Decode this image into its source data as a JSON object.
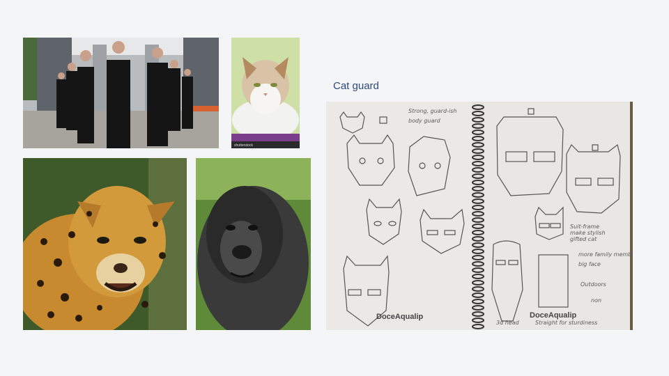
{
  "slide": {
    "title": "Cat guard"
  },
  "images": {
    "bodyguards": {
      "alt": "Group of bodyguards in black suits and sunglasses"
    },
    "cat": {
      "alt": "Cat lying on a purple blanket",
      "watermark": "shutterstock"
    },
    "jaguar": {
      "alt": "Jaguar close-up snarling"
    },
    "gorilla": {
      "alt": "Gorilla portrait"
    },
    "sketch": {
      "alt": "Sketchbook with cat and gorilla face drawings",
      "notes": [
        "Strong, guard-ish",
        "body guard",
        "Suit-frame",
        "make stylish",
        "gifted cat",
        "more family member",
        "big face",
        "Outdoors",
        "non",
        "3d head",
        "Straight for sturdiness"
      ],
      "watermarks": [
        "DoceAqualip",
        "DoceAqualip"
      ]
    }
  }
}
